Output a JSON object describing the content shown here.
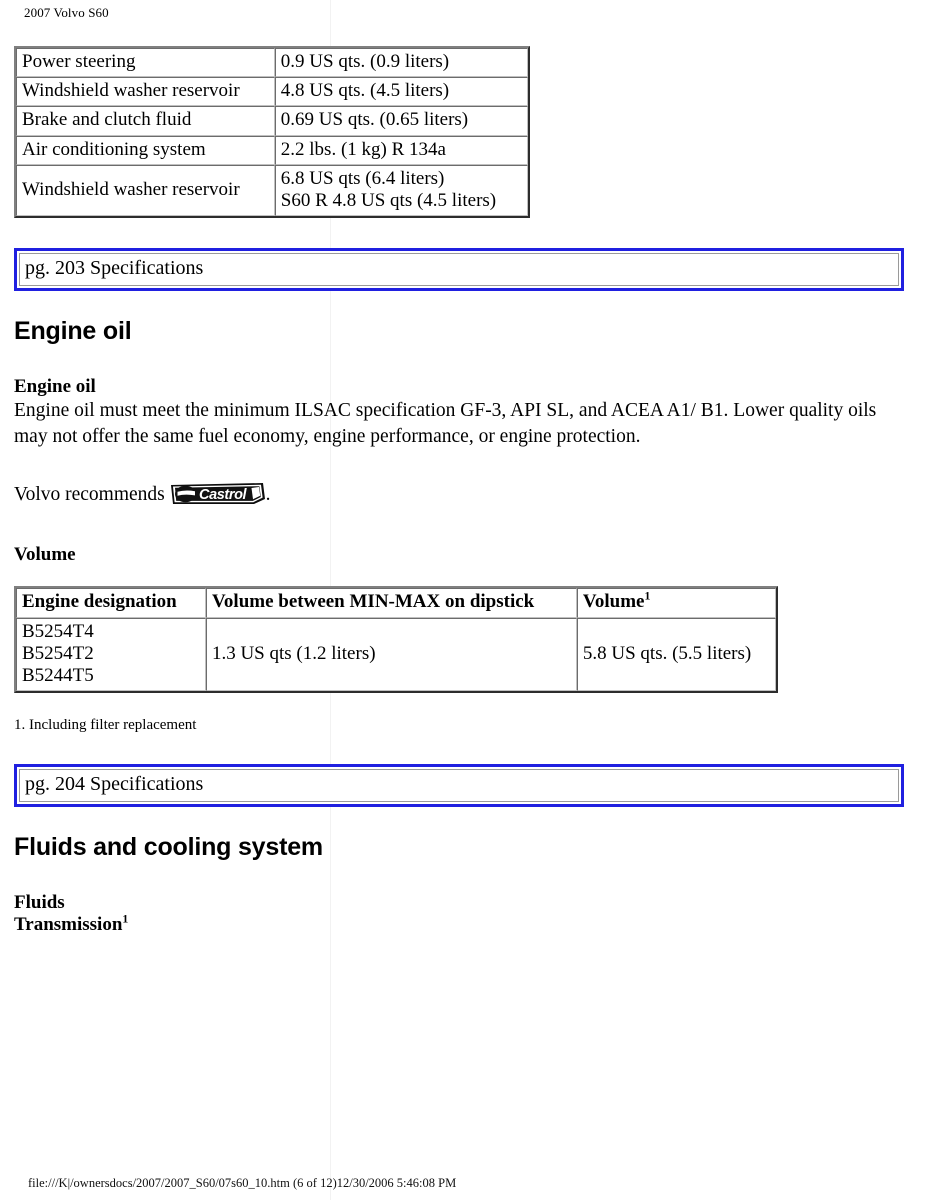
{
  "document": {
    "header": "2007 Volvo S60",
    "footer_path": "file:///K|/ownersdocs/2007/2007_S60/07s60_10.htm (6 of 12)12/30/2006 5:46:08 PM"
  },
  "colors": {
    "page_marker_border": "#2020e0",
    "table_border": "#808080",
    "cell_border": "#c0c0c0",
    "text": "#000000",
    "background": "#ffffff"
  },
  "fluid_capacities_table": {
    "rows": [
      {
        "label": "Power steering",
        "value": "0.9 US qts. (0.9 liters)"
      },
      {
        "label": "Windshield washer reservoir",
        "value": "4.8 US qts. (4.5 liters)"
      },
      {
        "label": "Brake and clutch fluid",
        "value": "0.69 US qts. (0.65 liters)"
      },
      {
        "label": "Air conditioning system",
        "value": "2.2 lbs. (1 kg) R 134a"
      },
      {
        "label": "Windshield washer reservoir",
        "value_line1": "6.8 US qts (6.4 liters)",
        "value_line2": "S60 R 4.8 US qts (4.5 liters)"
      }
    ]
  },
  "page_marker_203": {
    "label": "pg. 203 Specifications"
  },
  "engine_oil_section": {
    "heading": "Engine oil",
    "subheading": "Engine oil",
    "paragraph": "Engine oil must meet the minimum ILSAC specification GF-3, API SL, and ACEA A1/ B1. Lower quality oils may not offer the same fuel economy, engine performance, or engine protection.",
    "recommend_prefix": "Volvo recommends ",
    "recommend_brand": "Castrol",
    "recommend_suffix": ".",
    "volume_label": "Volume"
  },
  "engine_oil_volume_table": {
    "headers": {
      "col1": "Engine designation",
      "col2": "Volume between MIN-MAX on dipstick",
      "col3_text": "Volume",
      "col3_sup": "1"
    },
    "rows": [
      {
        "designations": [
          "B5254T4",
          "B5254T2",
          "B5244T5"
        ],
        "min_max": "1.3 US qts (1.2 liters)",
        "volume": "5.8 US qts. (5.5 liters)"
      }
    ],
    "footnote": "1. Including filter replacement"
  },
  "page_marker_204": {
    "label": "pg. 204 Specifications"
  },
  "fluids_section": {
    "heading": "Fluids and cooling system",
    "subheading": "Fluids",
    "line2_text": "Transmission",
    "line2_sup": "1"
  }
}
